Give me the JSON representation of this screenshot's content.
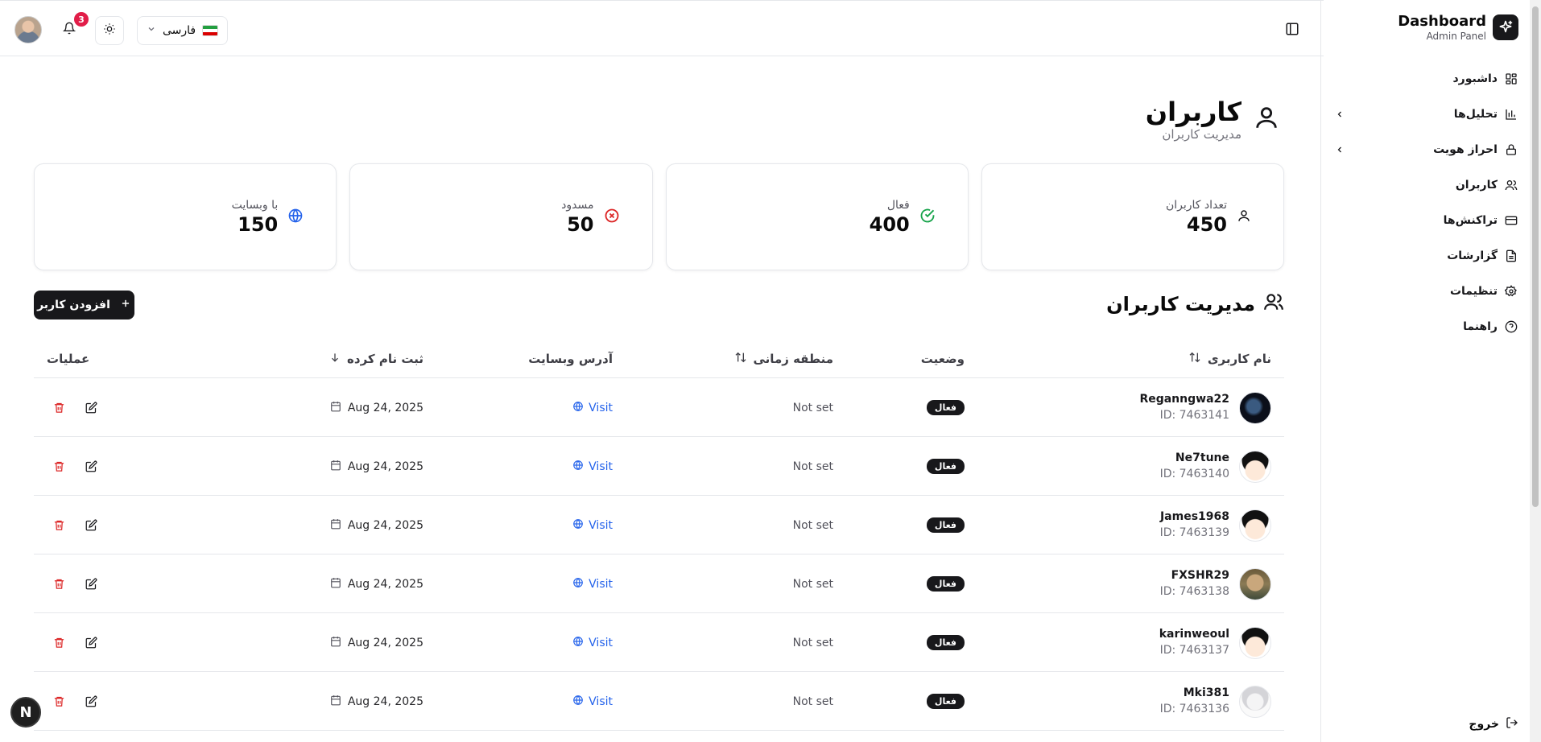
{
  "brand": {
    "title": "Dashboard",
    "subtitle": "Admin Panel"
  },
  "sidebar": {
    "items": [
      {
        "label": "داشبورد",
        "icon": "grid-icon"
      },
      {
        "label": "تحلیل‌ها",
        "icon": "bar-chart-icon",
        "expandable": true
      },
      {
        "label": "احراز هویت",
        "icon": "lock-icon",
        "expandable": true
      },
      {
        "label": "کاربران",
        "icon": "users-icon"
      },
      {
        "label": "تراکنش‌ها",
        "icon": "credit-card-icon"
      },
      {
        "label": "گزارشات",
        "icon": "file-text-icon"
      },
      {
        "label": "تنظیمات",
        "icon": "gear-icon"
      },
      {
        "label": "راهنما",
        "icon": "help-circle-icon"
      }
    ],
    "logout_label": "خروج"
  },
  "topbar": {
    "notification_count": "3",
    "language_label": "فارسی"
  },
  "page": {
    "title": "کاربران",
    "subtitle": "مدیریت کاربران"
  },
  "stats": [
    {
      "label": "تعداد کاربران",
      "value": "450",
      "icon": "user-icon",
      "color": "#18181b"
    },
    {
      "label": "فعال",
      "value": "400",
      "icon": "check-circle-icon",
      "color": "#16a34a"
    },
    {
      "label": "مسدود",
      "value": "50",
      "icon": "x-circle-icon",
      "color": "#dc2626"
    },
    {
      "label": "با وبسایت",
      "value": "150",
      "icon": "globe-icon",
      "color": "#2563eb"
    }
  ],
  "section": {
    "title": "مدیریت کاربران",
    "add_button": "افزودن کاربر"
  },
  "table": {
    "headers": {
      "username": "نام کاربری",
      "status": "وضعیت",
      "timezone": "منطقه زمانی",
      "website": "آدرس وبسایت",
      "registered": "ثبت نام کرده",
      "actions": "عملیات"
    },
    "rows": [
      {
        "name": "Reganngwa22",
        "id": "ID: 7463141",
        "status": "فعال",
        "timezone": "Not set",
        "website": "Visit",
        "date": "Aug 24, 2025",
        "avatar": "dark"
      },
      {
        "name": "Ne7tune",
        "id": "ID: 7463140",
        "status": "فعال",
        "timezone": "Not set",
        "website": "Visit",
        "date": "Aug 24, 2025",
        "avatar": "anime"
      },
      {
        "name": "James1968",
        "id": "ID: 7463139",
        "status": "فعال",
        "timezone": "Not set",
        "website": "Visit",
        "date": "Aug 24, 2025",
        "avatar": "anime"
      },
      {
        "name": "FXSHR29",
        "id": "ID: 7463138",
        "status": "فعال",
        "timezone": "Not set",
        "website": "Visit",
        "date": "Aug 24, 2025",
        "avatar": "photo"
      },
      {
        "name": "karinweoul",
        "id": "ID: 7463137",
        "status": "فعال",
        "timezone": "Not set",
        "website": "Visit",
        "date": "Aug 24, 2025",
        "avatar": "anime"
      },
      {
        "name": "Mki381",
        "id": "ID: 7463136",
        "status": "فعال",
        "timezone": "Not set",
        "website": "Visit",
        "date": "Aug 24, 2025",
        "avatar": "sketch"
      }
    ]
  },
  "dev_badge": "N"
}
